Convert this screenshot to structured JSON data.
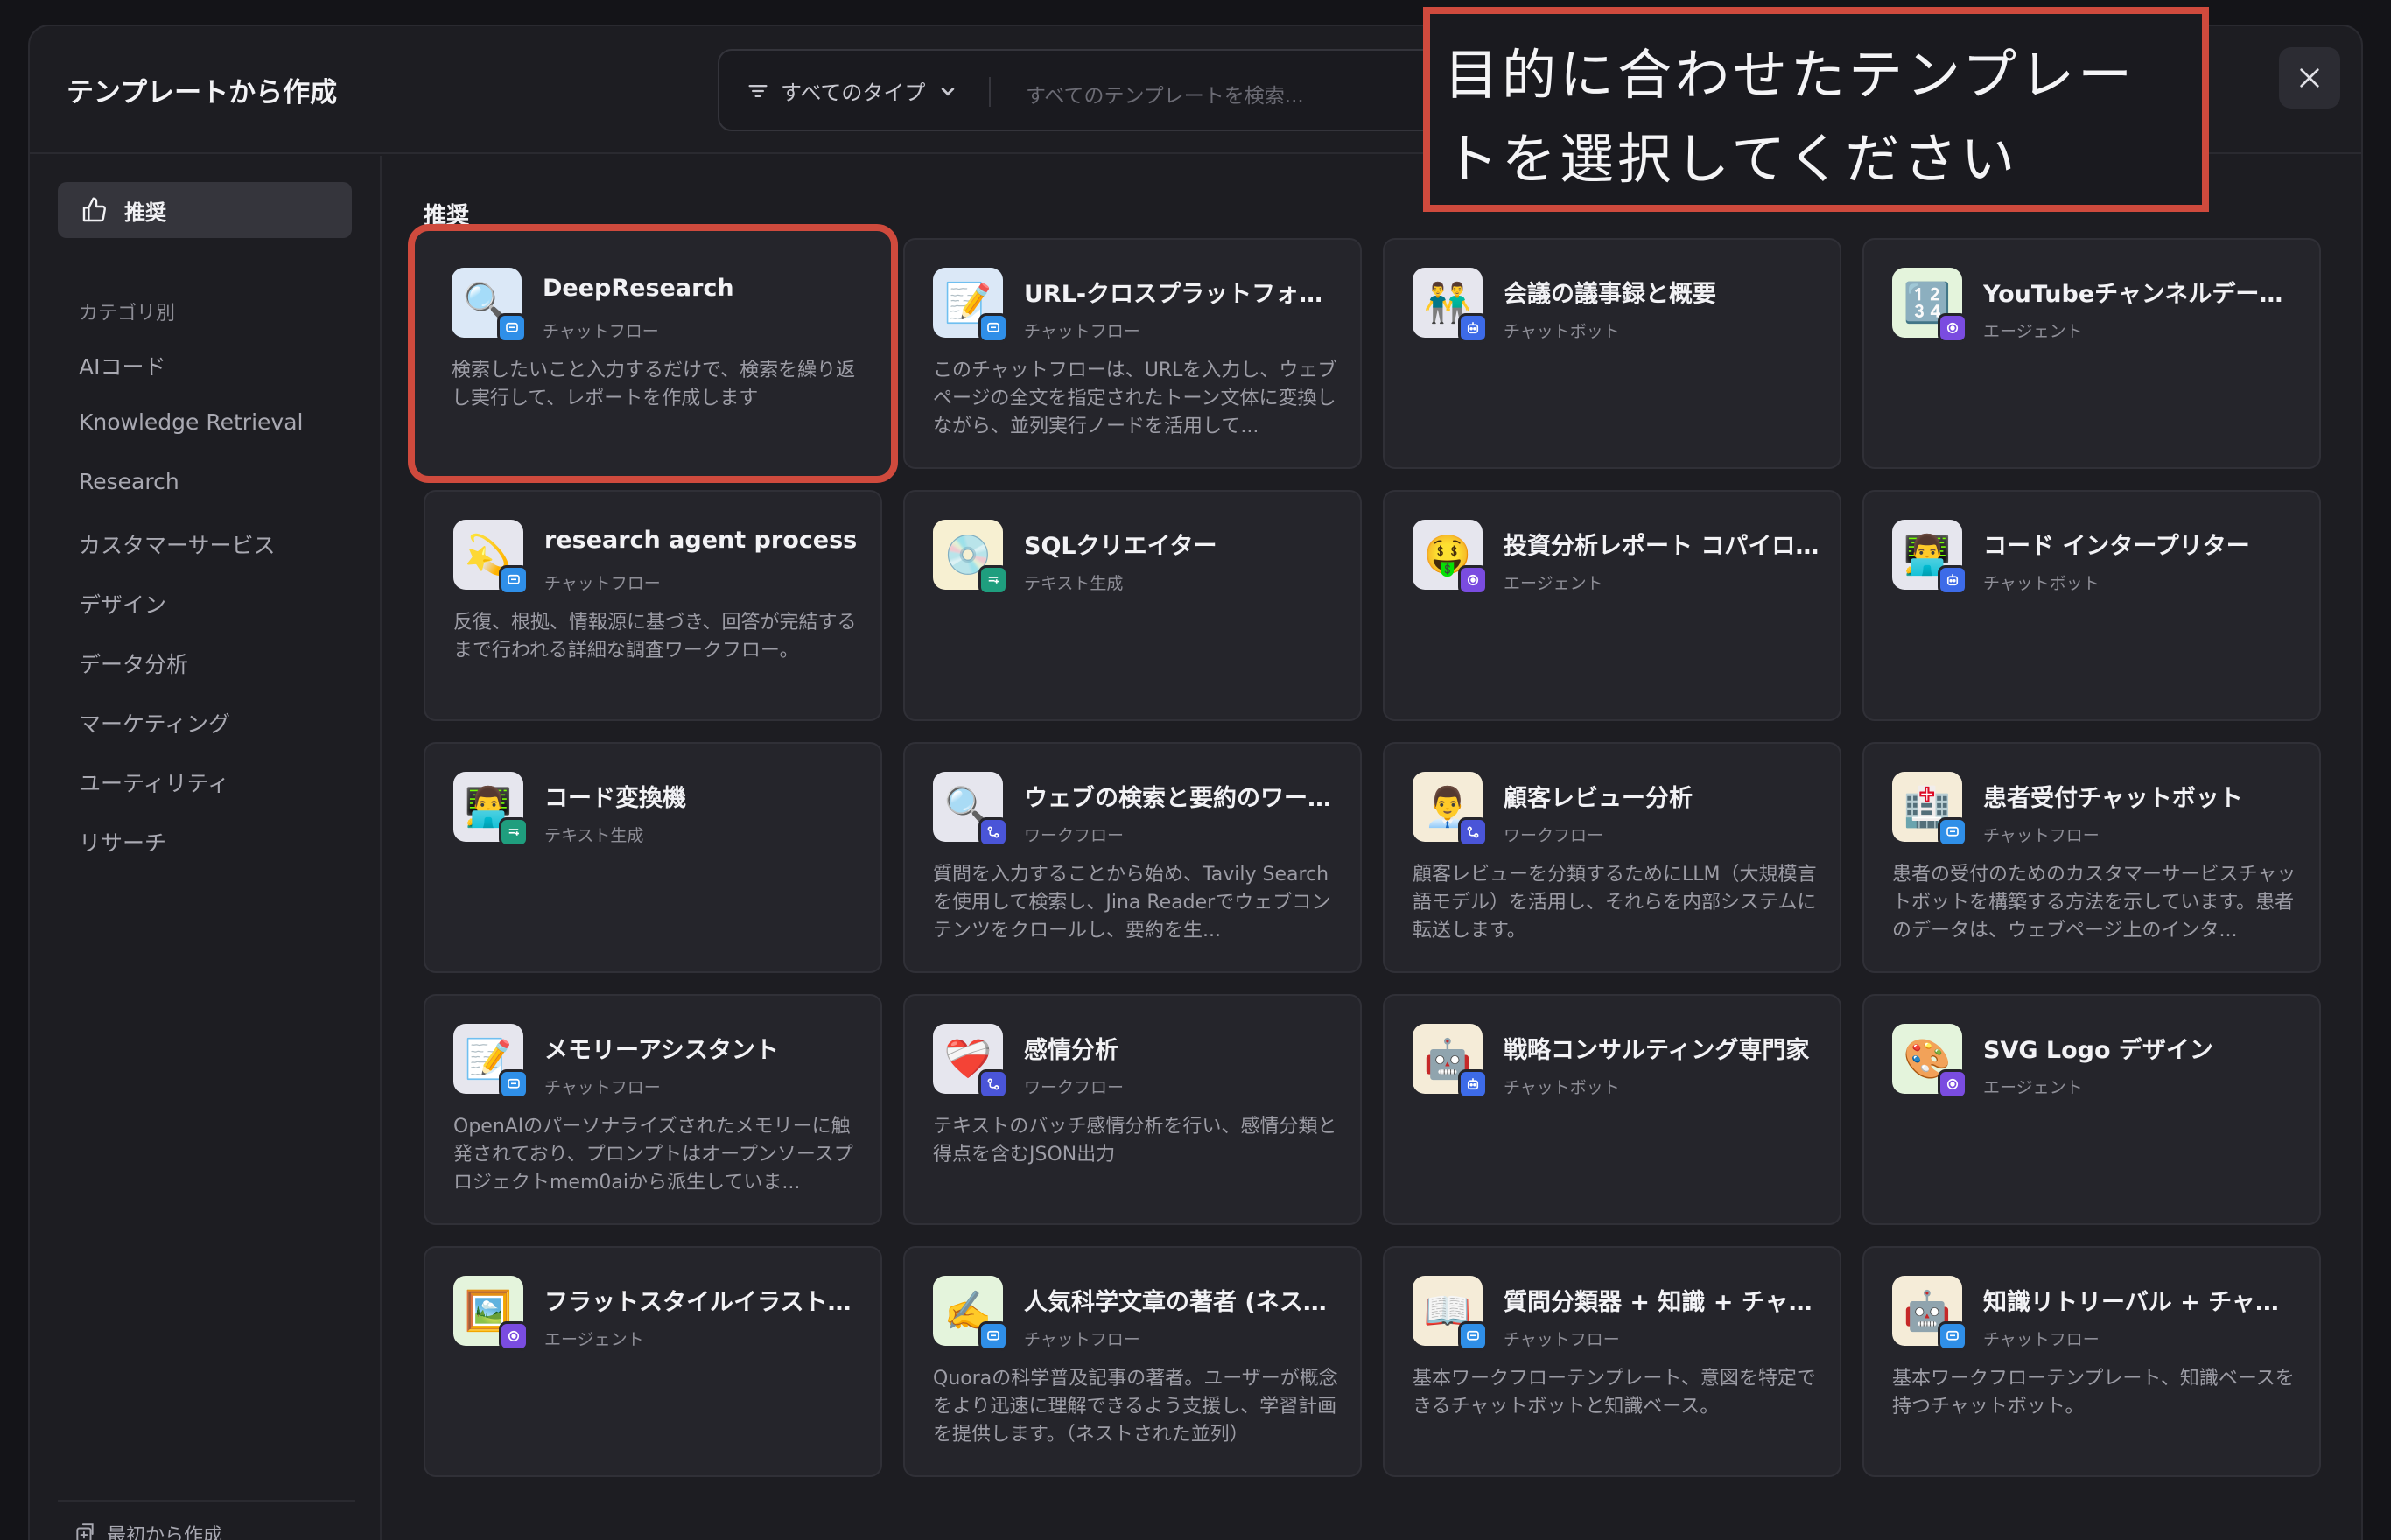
{
  "header": {
    "title": "テンプレートから作成",
    "type_filter": "すべてのタイプ",
    "search_placeholder": "すべてのテンプレートを検索..."
  },
  "callout": "目的に合わせたテンプレートを選択してください",
  "sidebar": {
    "recommended": "推奨",
    "category_label": "カテゴリ別",
    "items": [
      "AIコード",
      "Knowledge Retrieval",
      "Research",
      "カスタマーサービス",
      "デザイン",
      "データ分析",
      "マーケティング",
      "ユーティリティ",
      "リサーチ"
    ],
    "footer": "最初から作成"
  },
  "section_label": "推奨",
  "cards": [
    {
      "name": "DeepResearch",
      "type": "チャットフロー",
      "desc": "検索したいこと入力するだけで、検索を繰り返し実行して、レポートを作成します",
      "icon": "🔍",
      "icon_bg": "#dbe8f7",
      "badge": "chat",
      "badge_color": "#2f8fe8"
    },
    {
      "name": "URL-クロスプラットフォーム",
      "type": "チャットフロー",
      "desc": "このチャットフローは、URLを入力し、ウェブページの全文を指定されたトーン文体に変換しながら、並列実行ノードを活用して...",
      "icon": "📝",
      "icon_bg": "#dbe8f7",
      "badge": "chat",
      "badge_color": "#2f8fe8"
    },
    {
      "name": "会議の議事録と概要",
      "type": "チャットボット",
      "desc": "",
      "icon": "👬",
      "icon_bg": "#e6e6ee",
      "badge": "bot",
      "badge_color": "#3d6be8"
    },
    {
      "name": "YouTubeチャンネルデータ分析",
      "type": "エージェント",
      "desc": "",
      "icon": "🔢",
      "icon_bg": "#e4f4dc",
      "badge": "agent",
      "badge_color": "#7a4ce0"
    },
    {
      "name": "research agent process",
      "type": "チャットフロー",
      "desc": "反復、根拠、情報源に基づき、回答が完結するまで行われる詳細な調査ワークフロー。",
      "icon": "💫",
      "icon_bg": "#e6e6ee",
      "badge": "chat",
      "badge_color": "#2f8fe8"
    },
    {
      "name": "SQLクリエイター",
      "type": "テキスト生成",
      "desc": "",
      "icon": "💿",
      "icon_bg": "#f7f0d2",
      "badge": "text",
      "badge_color": "#1f9e7e"
    },
    {
      "name": "投資分析レポート コパイロット",
      "type": "エージェント",
      "desc": "",
      "icon": "🤑",
      "icon_bg": "#e6e6ee",
      "badge": "agent",
      "badge_color": "#7a4ce0"
    },
    {
      "name": "コード インタープリター",
      "type": "チャットボット",
      "desc": "",
      "icon": "👨‍💻",
      "icon_bg": "#e6e6ee",
      "badge": "bot",
      "badge_color": "#3d6be8"
    },
    {
      "name": "コード変換機",
      "type": "テキスト生成",
      "desc": "",
      "icon": "👨‍💻",
      "icon_bg": "#e6e6ee",
      "badge": "text",
      "badge_color": "#1f9e7e"
    },
    {
      "name": "ウェブの検索と要約のワークフローパターン",
      "type": "ワークフロー",
      "desc": "質問を入力することから始め、Tavily Searchを使用して検索し、Jina Readerでウェブコンテンツをクロールし、要約を生...",
      "icon": "🔍",
      "icon_bg": "#e6e6ee",
      "badge": "flow",
      "badge_color": "#4a55d8"
    },
    {
      "name": "顧客レビュー分析",
      "type": "ワークフロー",
      "desc": "顧客レビューを分類するためにLLM（大規模言語モデル）を活用し、それらを内部システムに転送します。",
      "icon": "👨‍💼",
      "icon_bg": "#f5ecd8",
      "badge": "flow",
      "badge_color": "#4a55d8"
    },
    {
      "name": "患者受付チャットボット",
      "type": "チャットフロー",
      "desc": "患者の受付のためのカスタマーサービスチャットボットを構築する方法を示しています。患者のデータは、ウェブページ上のインタ...",
      "icon": "🏥",
      "icon_bg": "#f5ecd8",
      "badge": "chat",
      "badge_color": "#2f8fe8"
    },
    {
      "name": "メモリーアシスタント",
      "type": "チャットフロー",
      "desc": "OpenAIのパーソナライズされたメモリーに触発されており、プロンプトはオープンソースプロジェクトmem0aiから派生していま...",
      "icon": "📝",
      "icon_bg": "#e6e6ee",
      "badge": "chat",
      "badge_color": "#2f8fe8"
    },
    {
      "name": "感情分析",
      "type": "ワークフロー",
      "desc": "テキストのバッチ感情分析を行い、感情分類と得点を含むJSON出力",
      "icon": "❤️‍🩹",
      "icon_bg": "#e6e6ee",
      "badge": "flow",
      "badge_color": "#4a55d8"
    },
    {
      "name": "戦略コンサルティング専門家",
      "type": "チャットボット",
      "desc": "",
      "icon": "🤖",
      "icon_bg": "#f5ecd8",
      "badge": "bot",
      "badge_color": "#3d6be8"
    },
    {
      "name": "SVG Logo デザイン",
      "type": "エージェント",
      "desc": "",
      "icon": "🎨",
      "icon_bg": "#e4f4dc",
      "badge": "agent",
      "badge_color": "#7a4ce0"
    },
    {
      "name": "フラットスタイルイラスト生成",
      "type": "エージェント",
      "desc": "",
      "icon": "🖼️",
      "icon_bg": "#e4f4dc",
      "badge": "agent",
      "badge_color": "#7a4ce0"
    },
    {
      "name": "人気科学文章の著者 (ネストされた並列)",
      "type": "チャットフロー",
      "desc": "Quoraの科学普及記事の著者。ユーザーが概念をより迅速に理解できるよう支援し、学習計画を提供します。（ネストされた並列）",
      "icon": "✍️",
      "icon_bg": "#e4f4dc",
      "badge": "chat",
      "badge_color": "#2f8fe8"
    },
    {
      "name": "質問分類器 + 知識 + チャットボット",
      "type": "チャットフロー",
      "desc": "基本ワークフローテンプレート、意図を特定できるチャットボットと知識ベース。",
      "icon": "📖",
      "icon_bg": "#f5ecd8",
      "badge": "chat",
      "badge_color": "#2f8fe8"
    },
    {
      "name": "知識リトリーバル + チャットボット",
      "type": "チャットフロー",
      "desc": "基本ワークフローテンプレート、知識ベースを持つチャットボット。",
      "icon": "🤖",
      "icon_bg": "#f5ecd8",
      "badge": "chat",
      "badge_color": "#2f8fe8"
    }
  ],
  "colors": {
    "accent_red": "#cf4a3d",
    "card_bg": "#25252b",
    "modal_bg": "#1d1d22"
  }
}
